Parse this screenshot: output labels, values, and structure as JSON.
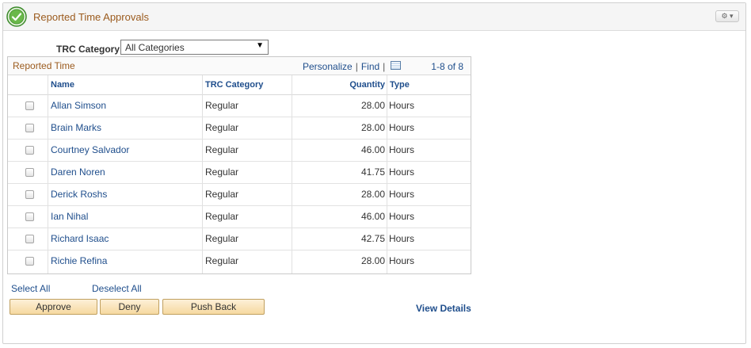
{
  "panel": {
    "title": "Reported Time Approvals",
    "settings_icon": "gear-icon",
    "status_icon": "check-circle-icon",
    "accent_color": "#9b5b1e",
    "link_color": "#1f4e8c"
  },
  "filter": {
    "label": "TRC Category",
    "selected": "All Categories"
  },
  "grid": {
    "title": "Reported Time",
    "personalize": "Personalize",
    "find": "Find",
    "separator": "|",
    "count": "1-8 of 8",
    "columns": {
      "name": "Name",
      "trc": "TRC Category",
      "quantity": "Quantity",
      "type": "Type"
    },
    "rows": [
      {
        "name": "Allan Simson",
        "trc": "Regular",
        "quantity": "28.00",
        "type": "Hours"
      },
      {
        "name": "Brain Marks",
        "trc": "Regular",
        "quantity": "28.00",
        "type": "Hours"
      },
      {
        "name": "Courtney Salvador",
        "trc": "Regular",
        "quantity": "46.00",
        "type": "Hours"
      },
      {
        "name": "Daren Noren",
        "trc": "Regular",
        "quantity": "41.75",
        "type": "Hours"
      },
      {
        "name": "Derick Roshs",
        "trc": "Regular",
        "quantity": "28.00",
        "type": "Hours"
      },
      {
        "name": "Ian Nihal",
        "trc": "Regular",
        "quantity": "46.00",
        "type": "Hours"
      },
      {
        "name": "Richard Isaac",
        "trc": "Regular",
        "quantity": "42.75",
        "type": "Hours"
      },
      {
        "name": "Richie Refina",
        "trc": "Regular",
        "quantity": "28.00",
        "type": "Hours"
      }
    ]
  },
  "actions": {
    "select_all": "Select All",
    "deselect_all": "Deselect All",
    "approve": "Approve",
    "deny": "Deny",
    "push_back": "Push Back",
    "view_details": "View Details"
  }
}
